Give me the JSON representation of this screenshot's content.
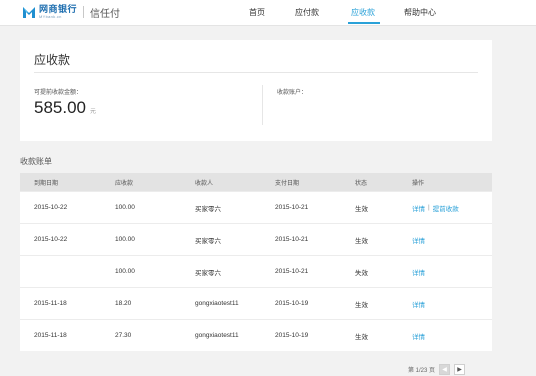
{
  "header": {
    "logo_cn": "网商银行",
    "logo_en": "MYbank.cn",
    "product": "信任付",
    "nav": [
      {
        "label": "首页",
        "active": false
      },
      {
        "label": "应付款",
        "active": false
      },
      {
        "label": "应收款",
        "active": true
      },
      {
        "label": "帮助中心",
        "active": false
      }
    ],
    "accent_color": "#2aa1d8"
  },
  "summary": {
    "title": "应收款",
    "amount_label": "可提前收款金额：",
    "amount_value": "585.00",
    "amount_unit": "元",
    "account_label": "收款账户："
  },
  "bill": {
    "section_title": "收款账单",
    "columns": [
      "到期日期",
      "应收款",
      "收款人",
      "支付日期",
      "状态",
      "操作"
    ],
    "rows": [
      {
        "due": "2015-10-22",
        "amount": "100.00",
        "payee": "买家零六",
        "paid": "2015-10-21",
        "status": "生效",
        "actions": [
          "详情",
          "提前收款"
        ]
      },
      {
        "due": "2015-10-22",
        "amount": "100.00",
        "payee": "买家零六",
        "paid": "2015-10-21",
        "status": "生效",
        "actions": [
          "详情"
        ]
      },
      {
        "due": "",
        "amount": "100.00",
        "payee": "买家零六",
        "paid": "2015-10-21",
        "status": "失效",
        "actions": [
          "详情"
        ]
      },
      {
        "due": "2015-11-18",
        "amount": "18.20",
        "payee": "gongxiaotest11",
        "paid": "2015-10-19",
        "status": "生效",
        "actions": [
          "详情"
        ]
      },
      {
        "due": "2015-11-18",
        "amount": "27.30",
        "payee": "gongxiaotest11",
        "paid": "2015-10-19",
        "status": "生效",
        "actions": [
          "详情"
        ]
      }
    ]
  },
  "pager": {
    "text": "第 1/23 页",
    "prev": "◀",
    "next": "▶"
  }
}
